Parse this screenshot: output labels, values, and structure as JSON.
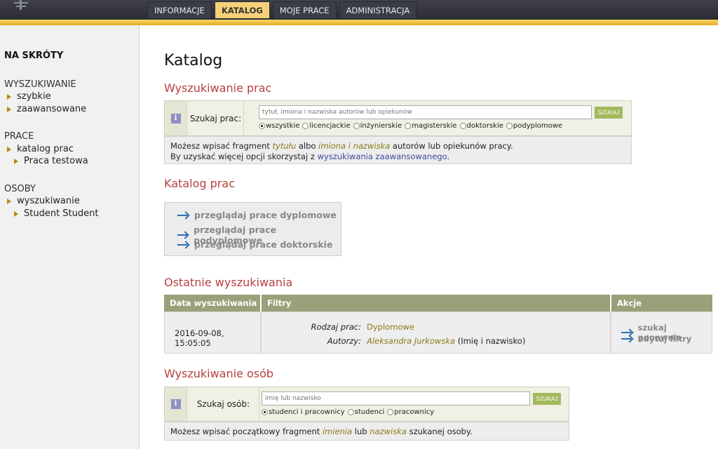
{
  "tabs": [
    "INFORMACJE",
    "KATALOG",
    "MOJE PRACE",
    "ADMINISTRACJA"
  ],
  "sidebar": {
    "heading": "NA SKRÓTY",
    "groups": [
      {
        "title": "WYSZUKIWANIE",
        "items": [
          "szybkie",
          "zaawansowane"
        ]
      },
      {
        "title": "PRACE",
        "items": [
          "katalog prac",
          "Praca testowa"
        ]
      },
      {
        "title": "OSOBY",
        "items": [
          "wyszukiwanie",
          "Student Student"
        ]
      }
    ]
  },
  "page_title": "Katalog",
  "search_works": {
    "title": "Wyszukiwanie prac",
    "label": "Szukaj prac:",
    "placeholder": "tytuł, imiona i nazwiska autorów lub opiekunów",
    "button": "SZUKAJ",
    "radios": [
      "wszystkie",
      "licencjackie",
      "inżynierskie",
      "magisterskie",
      "doktorskie",
      "podyplomowe"
    ],
    "note": {
      "p1": "Możesz wpisać fragment ",
      "em1": "tytułu",
      "p2": " albo ",
      "em2": "imiona i nazwiska",
      "p3": " autorów lub opiekunów pracy.",
      "p4": "By uzyskać więcej opcji skorzystaj z ",
      "link": "wyszukiwania zaawansowanego",
      "p5": "."
    }
  },
  "catalog": {
    "title": "Katalog prac",
    "links": [
      "przeglądaj prace dyplomowe",
      "przeglądaj prace podyplomowe",
      "przeglądaj prace doktorskie"
    ]
  },
  "recent": {
    "title": "Ostatnie wyszukiwania",
    "headers": [
      "Data wyszukiwania",
      "Filtry",
      "Akcje"
    ],
    "date": "2016-09-08, 15:05:05",
    "filters": [
      {
        "key": "Rodzaj prac:",
        "value": "Dyplomowe",
        "extra": ""
      },
      {
        "key": "Autorzy:",
        "value": "Aleksandra Jurkowska",
        "extra": " (Imię i nazwisko)"
      }
    ],
    "actions": [
      "szukaj ponownie",
      "edytuj filtry"
    ]
  },
  "search_people": {
    "title": "Wyszukiwanie osób",
    "label": "Szukaj osób:",
    "placeholder": "imię lub nazwisko",
    "button": "SZUKAJ",
    "radios": [
      "studenci i pracownicy",
      "studenci",
      "pracownicy"
    ],
    "note": {
      "p1": "Możesz wpisać początkowy fragment ",
      "em1": "imienia",
      "p2": " lub ",
      "em2": "nazwiska",
      "p3": " szukanej osoby."
    }
  }
}
